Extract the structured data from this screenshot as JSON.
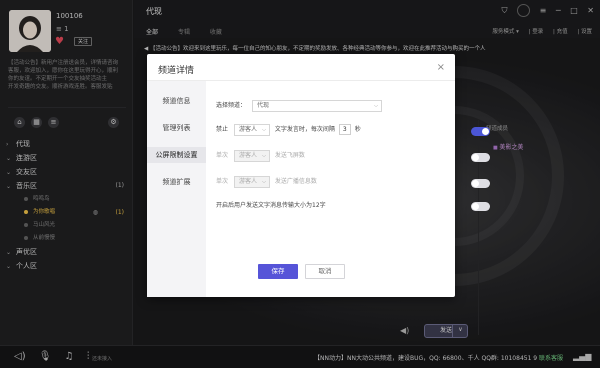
{
  "user": {
    "uid": "100106",
    "vip": "≡ 1",
    "follow_label": "关注"
  },
  "bio_lines": [
    "【活动公告】新用户注册送会员，详情请咨询",
    "客服，欢迎加入，愿你在这里玩得开心，顺利",
    "你的友谊。不定期开一个交友抽奖活动主",
    "开发奇趣的交友。顺祈游戏连胜。客服发贴"
  ],
  "tree": [
    {
      "label": "代现",
      "type": "root",
      "expand": "›"
    },
    {
      "label": "连游区",
      "type": "group",
      "expand": "⌄"
    },
    {
      "label": "交友区",
      "type": "group",
      "expand": "⌄"
    },
    {
      "label": "音乐区",
      "type": "group",
      "expand": "⌄",
      "count": "(1)"
    },
    {
      "label": "鸣鸣鸟",
      "type": "sub"
    },
    {
      "label": "为你歌唱",
      "type": "sub",
      "active": true,
      "count": "(1)"
    },
    {
      "label": "马山风光",
      "type": "sub"
    },
    {
      "label": "从前慢慢",
      "type": "sub"
    },
    {
      "label": "声优区",
      "type": "group",
      "expand": "⌄"
    },
    {
      "label": "个人区",
      "type": "group",
      "expand": "⌄"
    }
  ],
  "topbar": {
    "channel_title": "代现",
    "tabs": [
      "全部",
      "专辑",
      "收藏"
    ],
    "menu2": [
      "服务模式 ▾",
      "| 登录",
      "| 充值",
      "| 设置"
    ]
  },
  "marquee": "◀ 【活动公告】欢迎来到这里玩乐，每一位自己的知心朋友，不定期的奖励发放、各种经典活动等你参与，欢迎在此推荐活动与购买的一个人",
  "right_panel": {
    "label": "频道成员",
    "member": "美影之美"
  },
  "send": {
    "label": "发送",
    "arrow": "∨"
  },
  "bottom": {
    "label": "还未接入",
    "notice_prefix": "【NN动力】NN大动公共频道，建设BUG，QQ: 66800、千人 QQ群: 10108451 9 ",
    "notice_link": "联系客服"
  },
  "modal": {
    "title": "频道详情",
    "close": "×",
    "nav": [
      "频道信息",
      "管理列表",
      "公屏限制设置",
      "频道扩展"
    ],
    "select_channel_label": "选择频道：",
    "select_channel_value": "代现",
    "row1_prefix": "禁止",
    "row1_role": "游客人",
    "row1_mid": "文字发言时，每次间隔",
    "row1_value": "3",
    "row1_unit": "秒",
    "row2_prefix": "单次",
    "row2_role": "游客人",
    "row2_text": "发送飞屏数",
    "row3_prefix": "单次",
    "row3_role": "游客人",
    "row3_text": "发送广播信息数",
    "row4_text": "开启后用户发送文字消息传输大小为12字",
    "save_label": "保存",
    "cancel_label": "取消",
    "chev": "⌵"
  }
}
